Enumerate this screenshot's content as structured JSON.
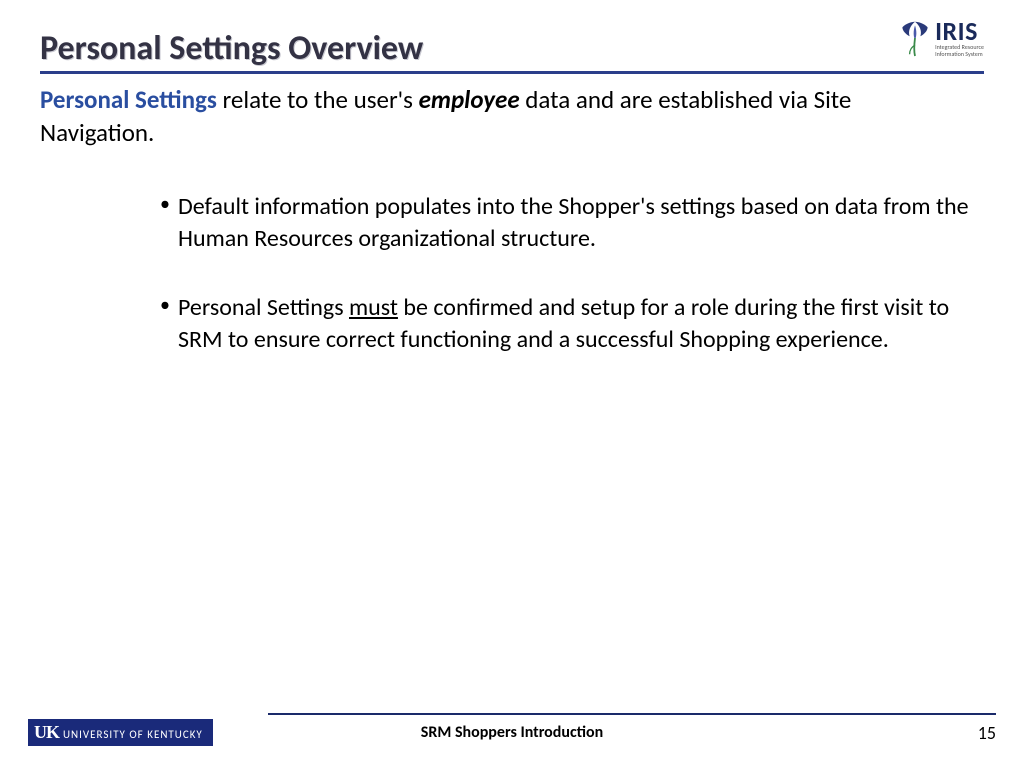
{
  "header": {
    "title": "Personal Settings Overview",
    "logo": {
      "name": "IRIS",
      "sub1": "Integrated Resource",
      "sub2": "Information System"
    }
  },
  "intro": {
    "lead": "Personal Settings",
    "mid1": " relate to the user's ",
    "emp": "employee",
    "mid2": " data and are established via Site Navigation."
  },
  "bullets": [
    {
      "pre": "Default information populates into the Shopper's settings based on data from the Human Resources organizational structure."
    },
    {
      "pre": "Personal Settings ",
      "under": "must",
      "post": " be confirmed and setup for a role during the first visit to SRM to ensure correct functioning and a successful Shopping experience."
    }
  ],
  "footer": {
    "org_mono": "UK",
    "org_name": "UNIVERSITY OF KENTUCKY",
    "doc_title": "SRM Shoppers Introduction",
    "page": "15"
  }
}
